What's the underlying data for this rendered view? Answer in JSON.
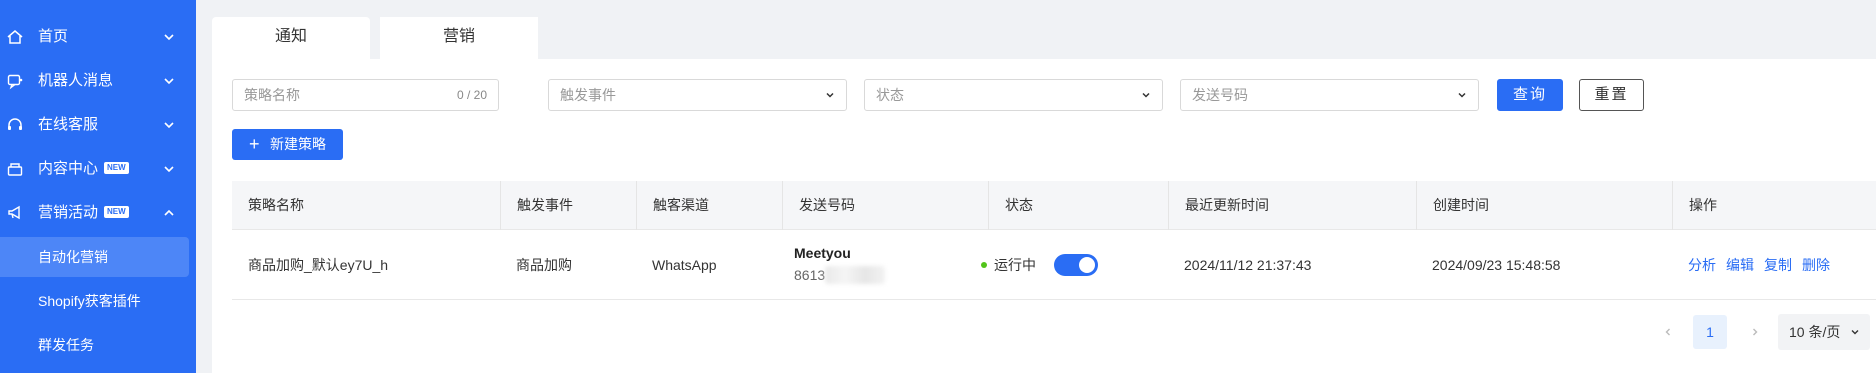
{
  "sidebar": {
    "items": [
      {
        "label": "首页",
        "icon": "home-icon"
      },
      {
        "label": "机器人消息",
        "icon": "robot-message-icon"
      },
      {
        "label": "在线客服",
        "icon": "headset-icon"
      },
      {
        "label": "内容中心",
        "icon": "content-icon",
        "badge": "NEW"
      },
      {
        "label": "营销活动",
        "icon": "megaphone-icon",
        "badge": "NEW"
      }
    ],
    "sub_items": [
      {
        "label": "自动化营销",
        "active": true
      },
      {
        "label": "Shopify获客插件"
      },
      {
        "label": "群发任务"
      }
    ]
  },
  "tabs": [
    {
      "label": "通知",
      "active": false
    },
    {
      "label": "营销",
      "active": true
    }
  ],
  "filters": {
    "strategy_name": {
      "placeholder": "策略名称",
      "count": "0 / 20"
    },
    "trigger_event": {
      "placeholder": "触发事件"
    },
    "status": {
      "placeholder": "状态"
    },
    "sender_number": {
      "placeholder": "发送号码"
    },
    "query_label": "查询",
    "reset_label": "重置"
  },
  "new_strategy_label": "新建策略",
  "table": {
    "columns": [
      "策略名称",
      "触发事件",
      "触客渠道",
      "发送号码",
      "状态",
      "最近更新时间",
      "创建时间",
      "操作"
    ],
    "rows": [
      {
        "name": "商品加购_默认ey7U_h",
        "trigger": "商品加购",
        "channel": "WhatsApp",
        "sender_name": "Meetyou",
        "sender_number": "8613",
        "status": "运行中",
        "enabled": true,
        "updated": "2024/11/12 21:37:43",
        "created": "2024/09/23 15:48:58",
        "actions": [
          "分析",
          "编辑",
          "复制",
          "删除"
        ]
      }
    ]
  },
  "pagination": {
    "current": "1",
    "page_size": "10 条/页"
  },
  "colors": {
    "primary": "#2a6df4",
    "status_running": "#52c41a"
  }
}
